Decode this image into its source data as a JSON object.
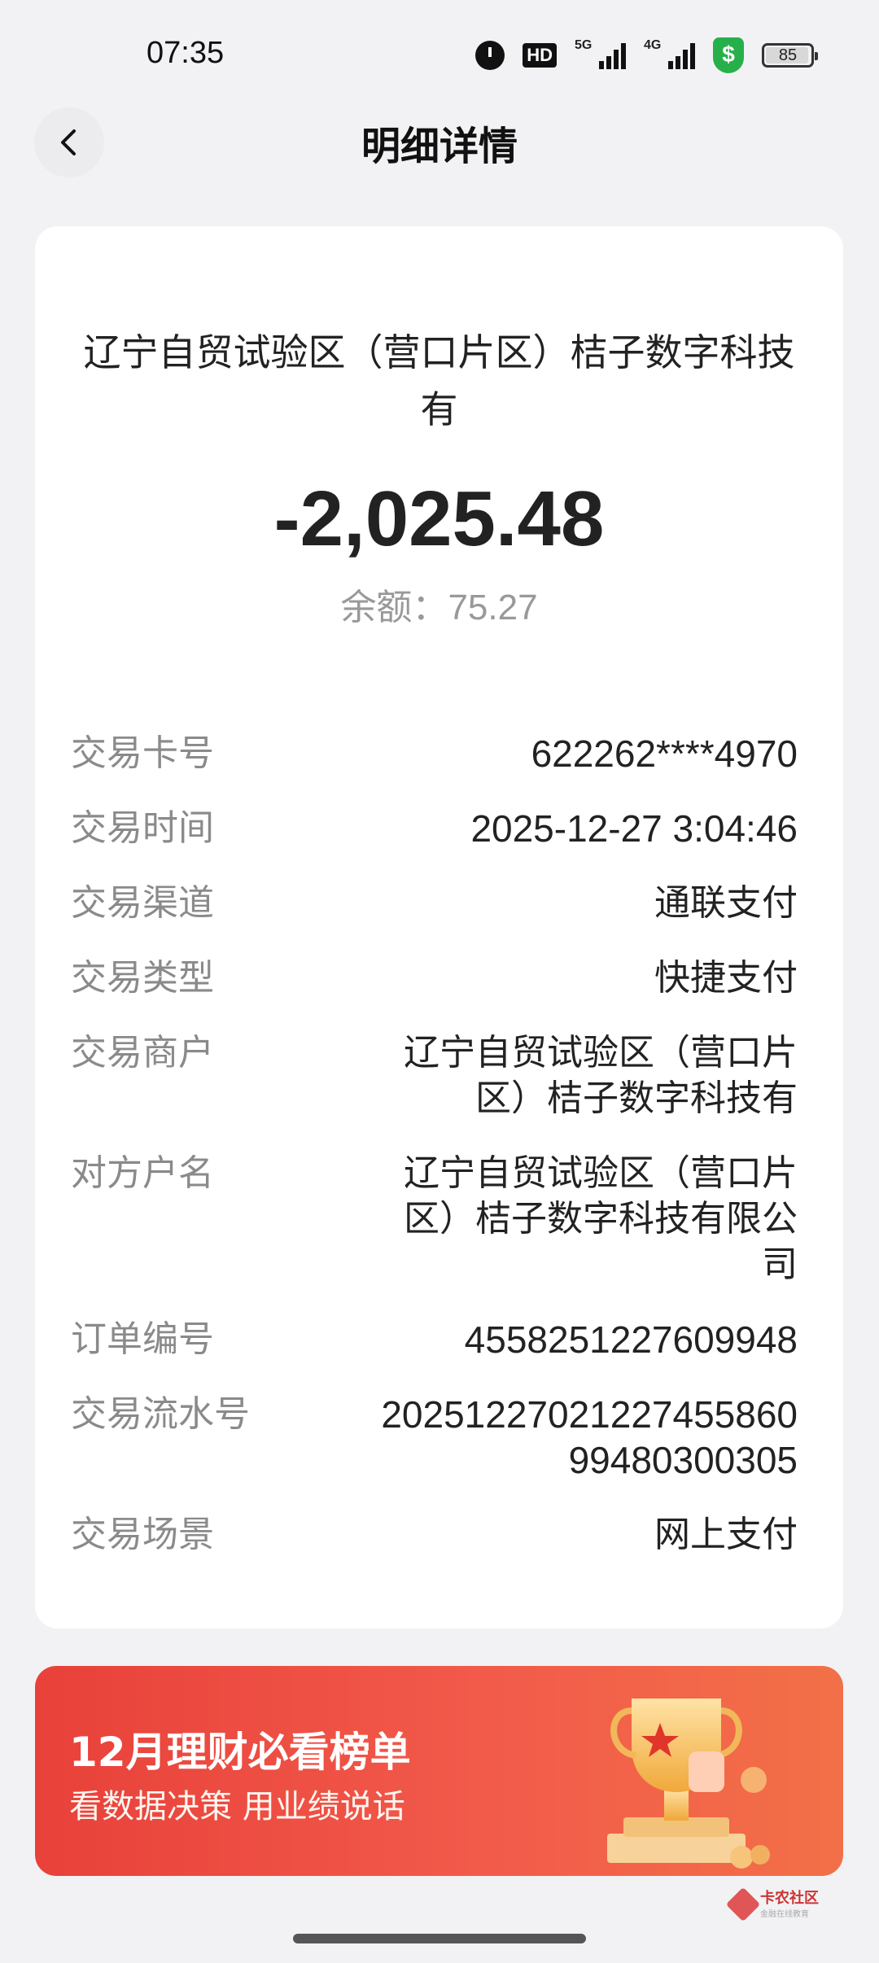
{
  "status_bar": {
    "time": "07:35",
    "hd_label": "HD",
    "network_1": "5G",
    "network_2": "4G",
    "shield_symbol": "$",
    "battery": "85"
  },
  "nav": {
    "title": "明细详情",
    "back_icon": "chevron-left-icon"
  },
  "summary": {
    "merchant": "辽宁自贸试验区（营口片区）桔子数字科技有",
    "amount": "-2,025.48",
    "balance_label": "余额：",
    "balance_value": "75.27"
  },
  "details": [
    {
      "label": "交易卡号",
      "value": "622262****4970"
    },
    {
      "label": "交易时间",
      "value": "2025-12-27 3:04:46"
    },
    {
      "label": "交易渠道",
      "value": "通联支付"
    },
    {
      "label": "交易类型",
      "value": "快捷支付"
    },
    {
      "label": "交易商户",
      "value": "辽宁自贸试验区（营口片区）桔子数字科技有"
    },
    {
      "label": "对方户名",
      "value": "辽宁自贸试验区（营口片区）桔子数字科技有限公司"
    },
    {
      "label": "订单编号",
      "value": "4558251227609948"
    },
    {
      "label": "交易流水号",
      "value": "2025122702122745586099480300305"
    },
    {
      "label": "交易场景",
      "value": "网上支付"
    }
  ],
  "banner": {
    "title": "12月理财必看榜单",
    "subtitle": "看数据决策 用业绩说话",
    "image_icon": "trophy-icon"
  },
  "watermark": {
    "text": "卡农社区",
    "subtext": "金融在线教育"
  },
  "colors": {
    "background": "#f2f2f4",
    "card": "#ffffff",
    "banner_red": "#e8413a",
    "label_gray": "#8a8a8a"
  }
}
